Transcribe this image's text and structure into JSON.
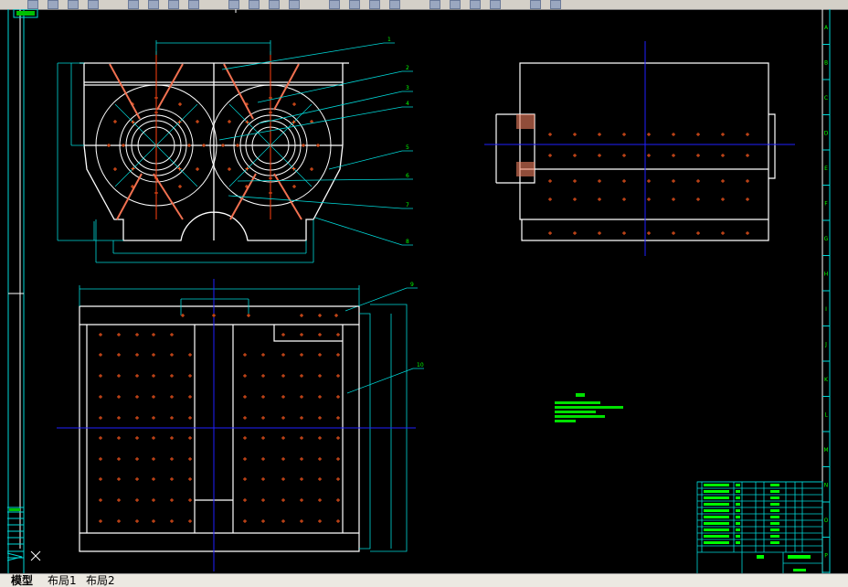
{
  "app": {
    "layer_name": "0"
  },
  "tabs": [
    {
      "label": "模型",
      "active": true
    },
    {
      "label": "布局1",
      "active": false
    },
    {
      "label": "布局2",
      "active": false
    }
  ],
  "leaders": [
    "1",
    "2",
    "3",
    "4",
    "5",
    "6",
    "7",
    "8",
    "9",
    "10"
  ],
  "border": {
    "letters": [
      "A",
      "B",
      "C",
      "D",
      "E",
      "F",
      "G",
      "H",
      "I",
      "J",
      "K",
      "L",
      "M",
      "N",
      "O",
      "P"
    ]
  },
  "colors": {
    "background": "#000000",
    "outline": "#ffffff",
    "dimension": "#00d8d8",
    "centerline": "#2020ff",
    "axis": "#ff4010",
    "text": "#00ff00",
    "marker": "#ff5a1e"
  },
  "icons": [
    "ucs-icon",
    "toolbar-icons"
  ]
}
